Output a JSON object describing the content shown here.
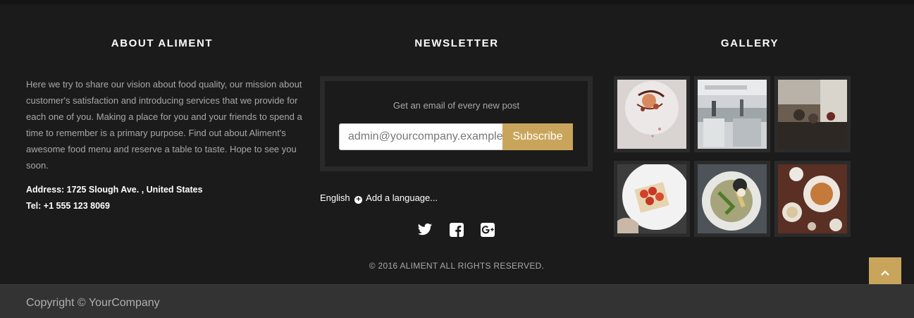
{
  "about": {
    "title": "ABOUT ALIMENT",
    "description": "Here we try to share our vision about food quality, our mission about customer's satisfaction and introducing services that we provide for each one of you. Making a place for you and your friends to spend a time to remember is a primary purpose. Find out about Aliment's awesome food menu and reserve a table to taste. Hope to see you soon.",
    "address": "Address: 1725 Slough Ave. , United States",
    "phone": "Tel: +1 555 123 8069"
  },
  "newsletter": {
    "title": "NEWSLETTER",
    "label": "Get an email of every new post",
    "input_value": "admin@yourcompany.example.com",
    "button_label": "Subscribe"
  },
  "language": {
    "current": "English",
    "add_label": "Add a language..."
  },
  "social": [
    "twitter-icon",
    "facebook-icon",
    "google-plus-icon"
  ],
  "copyright_mid": "© 2016 ALIMENT ALL RIGHTS RESERVED.",
  "gallery": {
    "title": "GALLERY",
    "images": [
      "dessert-plate",
      "restaurant-kitchen",
      "dining-room",
      "tomato-dish",
      "salad-bowl",
      "table-dishes"
    ]
  },
  "bottom": {
    "copyright": "Copyright © YourCompany"
  },
  "colors": {
    "accent": "#c9a55c",
    "background": "#1b1b1b",
    "bottom_bar": "#333333"
  }
}
